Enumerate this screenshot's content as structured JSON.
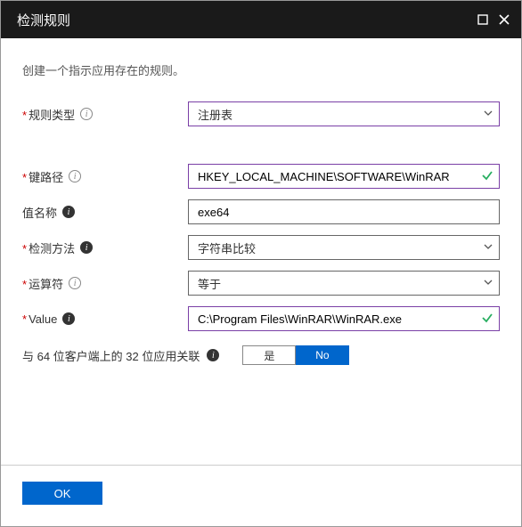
{
  "header": {
    "title": "检测规则"
  },
  "subtitle": "创建一个指示应用存在的规则。",
  "fields": {
    "ruleType": {
      "label": "规则类型",
      "value": "注册表",
      "required": true,
      "infoStyle": "light"
    },
    "keyPath": {
      "label": "键路径",
      "value": "HKEY_LOCAL_MACHINE\\SOFTWARE\\WinRAR",
      "required": true,
      "valid": true,
      "infoStyle": "light"
    },
    "valueName": {
      "label": "值名称",
      "value": "exe64",
      "required": false,
      "infoStyle": "dark"
    },
    "method": {
      "label": "检测方法",
      "value": "字符串比较",
      "required": true,
      "infoStyle": "dark"
    },
    "operator": {
      "label": "运算符",
      "value": "等于",
      "required": true,
      "infoStyle": "light"
    },
    "value": {
      "label": "Value",
      "value": "C:\\Program Files\\WinRAR\\WinRAR.exe",
      "required": true,
      "valid": true,
      "infoStyle": "dark"
    }
  },
  "toggle": {
    "label": "与 64 位客户端上的 32 位应用关联",
    "yes": "是",
    "no": "No",
    "selected": "no"
  },
  "footer": {
    "ok": "OK"
  },
  "colors": {
    "accent": "#0066cc",
    "purple": "#7a3fa6",
    "valid": "#27ae60"
  }
}
